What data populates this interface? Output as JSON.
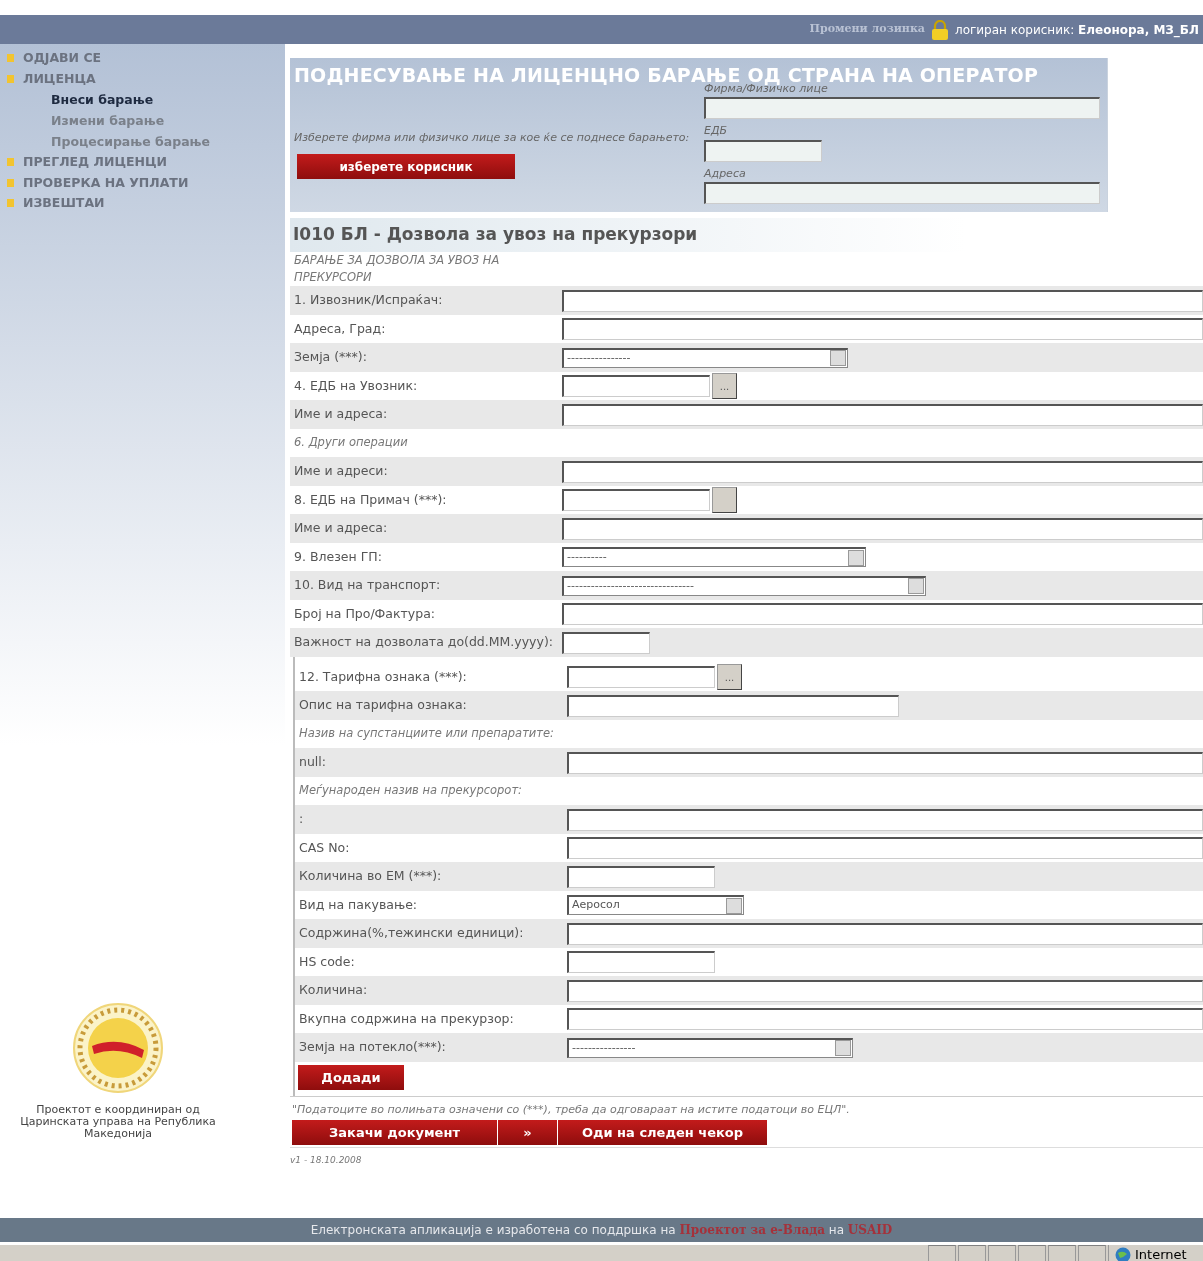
{
  "header": {
    "change_password": "Промени лозинка",
    "user_label": "логиран корисник: ",
    "user_name": "Елеонора, МЗ_БЛ"
  },
  "sidebar": {
    "items": [
      {
        "label": "ОДЈАВИ СЕ"
      },
      {
        "label": "ЛИЦЕНЦА",
        "children": [
          {
            "label": "Внеси барање",
            "selected": true
          },
          {
            "label": "Измени барање",
            "selected": false
          },
          {
            "label": "Процесирање барање",
            "selected": false
          }
        ]
      },
      {
        "label": "ПРЕГЛЕД ЛИЦЕНЦИ"
      },
      {
        "label": "ПРОВЕРКА НА УПЛАТИ"
      },
      {
        "label": "ИЗВЕШТАИ"
      }
    ],
    "credit": "Проектот е координиран од Царинската управа на Република Македонија"
  },
  "page_title": "ПОДНЕСУВАЊЕ НА ЛИЦЕНЦНО БАРАЊЕ ОД СТРАНА НА ОПЕРАТОР",
  "operator": {
    "prompt": "Изберете фирма или физичко лице за кое ќе се поднесе барањето:",
    "button": "изберете корисник",
    "fields": [
      {
        "label": "Фирма/Физичко лице"
      },
      {
        "label": "ЕДБ"
      },
      {
        "label": "Адреса"
      }
    ]
  },
  "form_title": "I010 БЛ - Дозвола за увоз на прекурзори",
  "rows": [
    {
      "kind": "heading",
      "label": "БАРАЊЕ ЗА ДОЗВОЛА ЗА УВОЗ НА ПРЕКУРСОРИ"
    },
    {
      "kind": "text",
      "label": "1. Извозник/Испраќач:"
    },
    {
      "kind": "text",
      "label": "Адреса, Град:"
    },
    {
      "kind": "select",
      "label": "Земја (***):",
      "value": "----------------"
    },
    {
      "kind": "lookup",
      "label": "4. ЕДБ на Увозник:",
      "button": "..."
    },
    {
      "kind": "text",
      "label": "Име и адреса:"
    },
    {
      "kind": "heading",
      "label": "6. Други операции"
    },
    {
      "kind": "text",
      "label": "Име и адреси:"
    },
    {
      "kind": "lookup",
      "label": "8. ЕДБ на Примач (***):"
    },
    {
      "kind": "text",
      "label": "Име и адреса:"
    },
    {
      "kind": "select",
      "label": "9. Влезен ГП:",
      "value": "----------"
    },
    {
      "kind": "select",
      "label": "10. Вид на транспорт:",
      "value": "--------------------------------"
    },
    {
      "kind": "text",
      "label": "Број на Про/Фактура:"
    },
    {
      "kind": "date",
      "label": "Важност на дозволата до(dd.MM.yyyy):"
    }
  ],
  "tariff_rows": [
    {
      "kind": "lookup",
      "label": "12. Тарифна ознака (***):",
      "button": "..."
    },
    {
      "kind": "half",
      "label": "Опис на тарифна ознака:"
    },
    {
      "kind": "heading",
      "label": "Назив на супстанциите или препаратите:"
    },
    {
      "kind": "text",
      "label": "null:"
    },
    {
      "kind": "heading",
      "label": "Меѓународен назив на прекурсорот:"
    },
    {
      "kind": "text",
      "label": ":"
    },
    {
      "kind": "text",
      "label": "CAS No:"
    },
    {
      "kind": "short",
      "label": "Количина во ЕМ (***):"
    },
    {
      "kind": "select",
      "label": "Вид на пакување:",
      "value": "Аеросол"
    },
    {
      "kind": "text",
      "label": "Содржина(%,тежински единици):"
    },
    {
      "kind": "short",
      "label": "HS code:"
    },
    {
      "kind": "text",
      "label": "Количина:"
    },
    {
      "kind": "text",
      "label": "Вкупна содржина на прекурзор:"
    },
    {
      "kind": "select",
      "label": "Земја на потекло(***):",
      "value": "----------------"
    }
  ],
  "add_button": "Додади",
  "note": "\"Податоците во полињата означени со (***), треба да одговараат на истите податоци во ЕЦЛ\".",
  "actions": [
    {
      "label": "Закачи документ"
    },
    {
      "label": "»"
    },
    {
      "label": "Оди на следен чекор"
    }
  ],
  "version": "v1 - 18.10.2008",
  "footer": {
    "text": "Електронската апликација е изработена со поддршка на ",
    "link1": "Проектот за е-Влада",
    "middle": " на ",
    "link2": "USAID"
  },
  "status_bar": {
    "zone": "Internet"
  }
}
